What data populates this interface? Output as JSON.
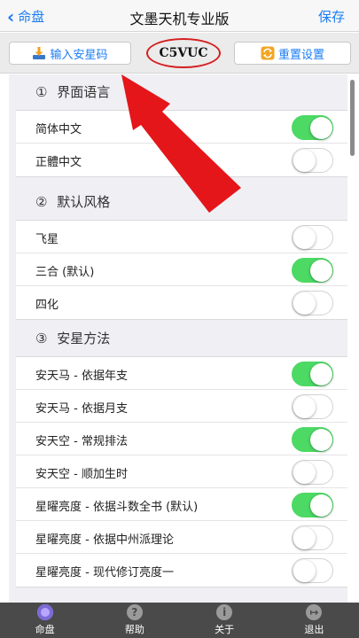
{
  "nav": {
    "back_label": "命盘",
    "title": "文墨天机专业版",
    "save_label": "保存"
  },
  "toolbar": {
    "input_label": "输入安星码",
    "code": "C5VUC",
    "reset_label": "重置设置"
  },
  "sections": [
    {
      "num": "①",
      "title": "界面语言",
      "rows": [
        {
          "label": "简体中文",
          "on": true
        },
        {
          "label": "正體中文",
          "on": false
        }
      ]
    },
    {
      "num": "②",
      "title": "默认风格",
      "rows": [
        {
          "label": "飞星",
          "on": false
        },
        {
          "label": "三合 (默认)",
          "on": true
        },
        {
          "label": "四化",
          "on": false
        }
      ]
    },
    {
      "num": "③",
      "title": "安星方法",
      "rows": [
        {
          "label": "安天马 - 依据年支",
          "on": true
        },
        {
          "label": "安天马 - 依据月支",
          "on": false
        },
        {
          "label": "安天空 - 常规排法",
          "on": true
        },
        {
          "label": "安天空 - 顺加生时",
          "on": false
        },
        {
          "label": "星曜亮度 - 依据斗数全书 (默认)",
          "on": true
        },
        {
          "label": "星曜亮度 - 依据中州派理论",
          "on": false
        },
        {
          "label": "星曜亮度 - 现代修订亮度一",
          "on": false
        }
      ]
    }
  ],
  "tabs": [
    {
      "label": "命盘",
      "icon": "chart-disc-icon",
      "glyph": ""
    },
    {
      "label": "帮助",
      "icon": "help-icon",
      "glyph": "?"
    },
    {
      "label": "关于",
      "icon": "info-icon",
      "glyph": "i"
    },
    {
      "label": "退出",
      "icon": "exit-icon",
      "glyph": "↦"
    }
  ],
  "colors": {
    "accent": "#1a7cf5",
    "toggle_on": "#4cd964",
    "annotation": "#e4161a",
    "tabbar": "#4a4a4a"
  }
}
